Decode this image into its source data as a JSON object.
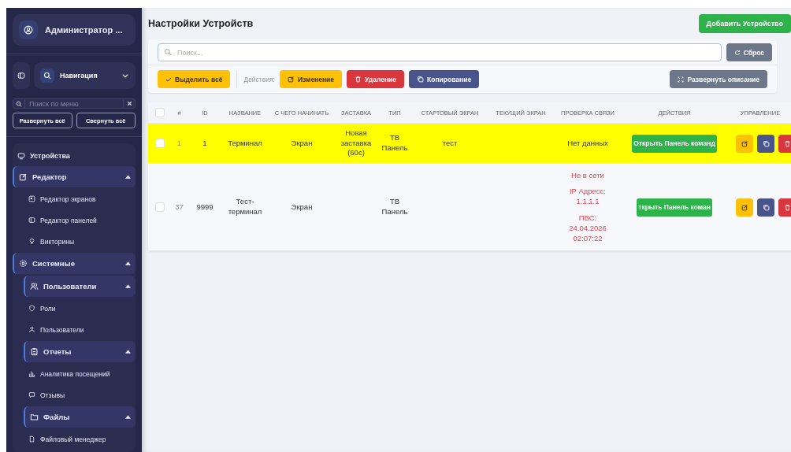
{
  "sidebar": {
    "user": "Администратор ...",
    "nav_label": "Навигация",
    "menu_search": {
      "placeholder": "Поиск по меню"
    },
    "expand_all": "Развернуть всё",
    "collapse_all": "Свернуть всё",
    "items": [
      {
        "label": "Устройства"
      },
      {
        "label": "Редактор",
        "expanded": true,
        "children": [
          {
            "label": "Редактор экранов"
          },
          {
            "label": "Редактор панелей"
          },
          {
            "label": "Викторины"
          }
        ]
      },
      {
        "label": "Системные",
        "expanded": true,
        "children": [
          {
            "label": "Пользователи",
            "expanded": true,
            "children": [
              {
                "label": "Роли"
              },
              {
                "label": "Пользователи"
              }
            ]
          },
          {
            "label": "Отчеты",
            "expanded": true,
            "children": [
              {
                "label": "Аналитика посещений"
              },
              {
                "label": "Отзывы"
              }
            ]
          },
          {
            "label": "Файлы",
            "expanded": true,
            "children": [
              {
                "label": "Файловый менеджер"
              }
            ]
          }
        ]
      }
    ]
  },
  "page": {
    "title": "Настройки Устройств",
    "add_button": "Добавить Устройство"
  },
  "toolbar": {
    "search": {
      "placeholder": "Поиск..."
    },
    "reset": "Сброс",
    "select_all": "Выделить всё",
    "actions_label": "Действия:",
    "actions": [
      {
        "label": "Изменение",
        "kind": "edit"
      },
      {
        "label": "Удаление",
        "kind": "delete"
      },
      {
        "label": "Копирование",
        "kind": "copy"
      }
    ],
    "expand_description": "Развернуть описание"
  },
  "table": {
    "header_checked": false,
    "columns": [
      "#",
      "ID",
      "НАЗВАНИЕ",
      "С ЧЕГО НАЧИНАТЬ",
      "ЗАСТАВКА",
      "ТИП",
      "СТАРТОВЫЙ ЭКРАН",
      "ТЕКУЩИЙ ЭКРАН",
      "ПРОВЕРКА СВЯЗИ",
      "ДЕЙСТВИЯ",
      "УПРАВЛЕНИЕ"
    ],
    "rows": [
      {
        "checked": false,
        "highlighted": true,
        "number": "1",
        "id": "1",
        "name": "Терминал",
        "start_with": "Экран",
        "screensaver": "Новая заставка (60с)",
        "type": "ТВ Панель",
        "start_screen": "тест",
        "connection": {
          "offline": false,
          "lines": [
            "Нет данных"
          ]
        },
        "action": "Открыть Панель команд"
      },
      {
        "checked": false,
        "highlighted": false,
        "number": "37",
        "id": "9999",
        "name": "Тест-терминал",
        "start_with": "Экран",
        "type": "ТВ Панель",
        "connection": {
          "offline": true,
          "lines": [
            "Не в сети",
            "IP Адресс: 1.1.1.1",
            "ПВС: 24.04.2026 02:07:22"
          ]
        },
        "action": "ткрыть Панель коман"
      }
    ]
  }
}
